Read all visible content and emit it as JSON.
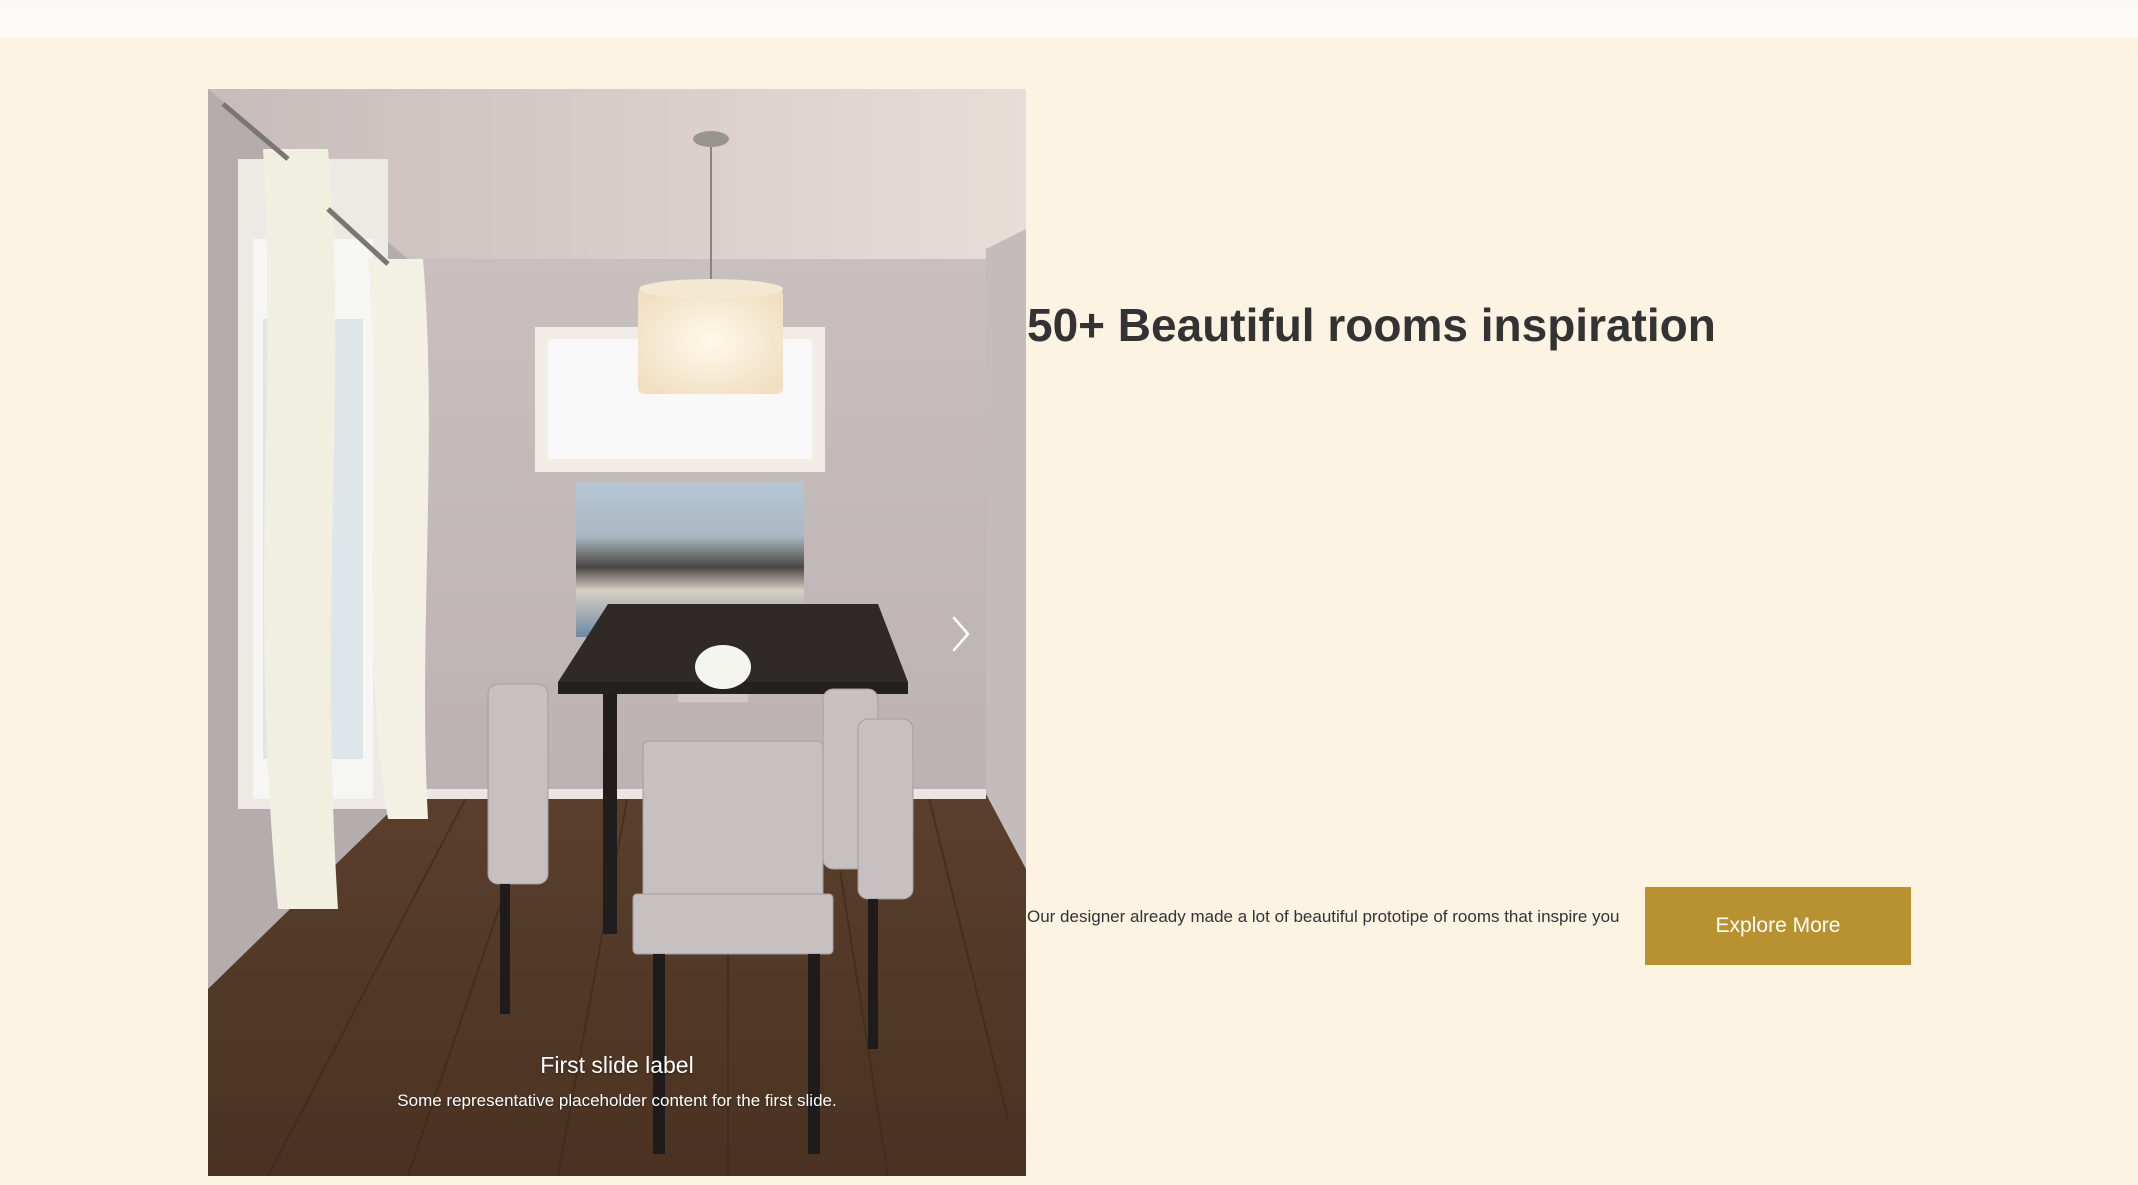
{
  "hero": {
    "title": "50+ Beautiful rooms inspiration",
    "description": "Our designer already made a lot of beautiful prototipe of rooms that inspire you",
    "button_label": "Explore More",
    "accent_color": "#b89230",
    "background_color": "#fdf3e3"
  },
  "carousel": {
    "active_index": 0,
    "slide_count": 4,
    "caption_title": "First slide label",
    "caption_text": "Some representative placeholder content for the first slide.",
    "next_icon": "chevron-right-icon"
  }
}
